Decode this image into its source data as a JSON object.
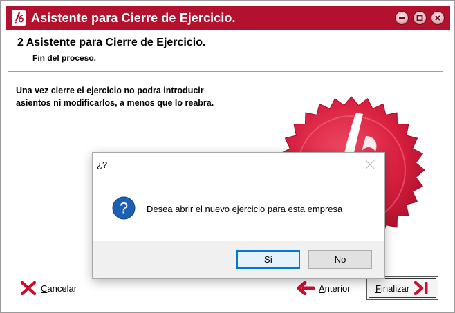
{
  "window": {
    "title": "Asistente para Cierre de Ejercicio.",
    "accent_color": "#b3112e",
    "title_buttons": [
      "minimize-icon",
      "maximize-icon",
      "close-icon"
    ]
  },
  "wizard": {
    "step_title": "2 Asistente para Cierre de Ejercicio.",
    "step_subtitle": "Fin del proceso.",
    "body_line1": "Una vez cierre el ejercicio no podra introducir",
    "body_line2": "asientos ni modificarlos, a menos que lo reabra."
  },
  "buttons": {
    "cancel": {
      "underline": "C",
      "rest": "ancelar",
      "icon": "red-x-icon"
    },
    "previous": {
      "underline": "A",
      "rest": "nterior",
      "icon": "left-arrow-icon"
    },
    "finish": {
      "underline": "F",
      "rest": "inalizar",
      "icon": "finish-arrow-icon"
    }
  },
  "dialog": {
    "title": "¿?",
    "message": "Desea abrir el nuevo ejercicio para esta empresa",
    "icon": "question-icon",
    "yes_label": "Sí",
    "no_label": "No"
  }
}
